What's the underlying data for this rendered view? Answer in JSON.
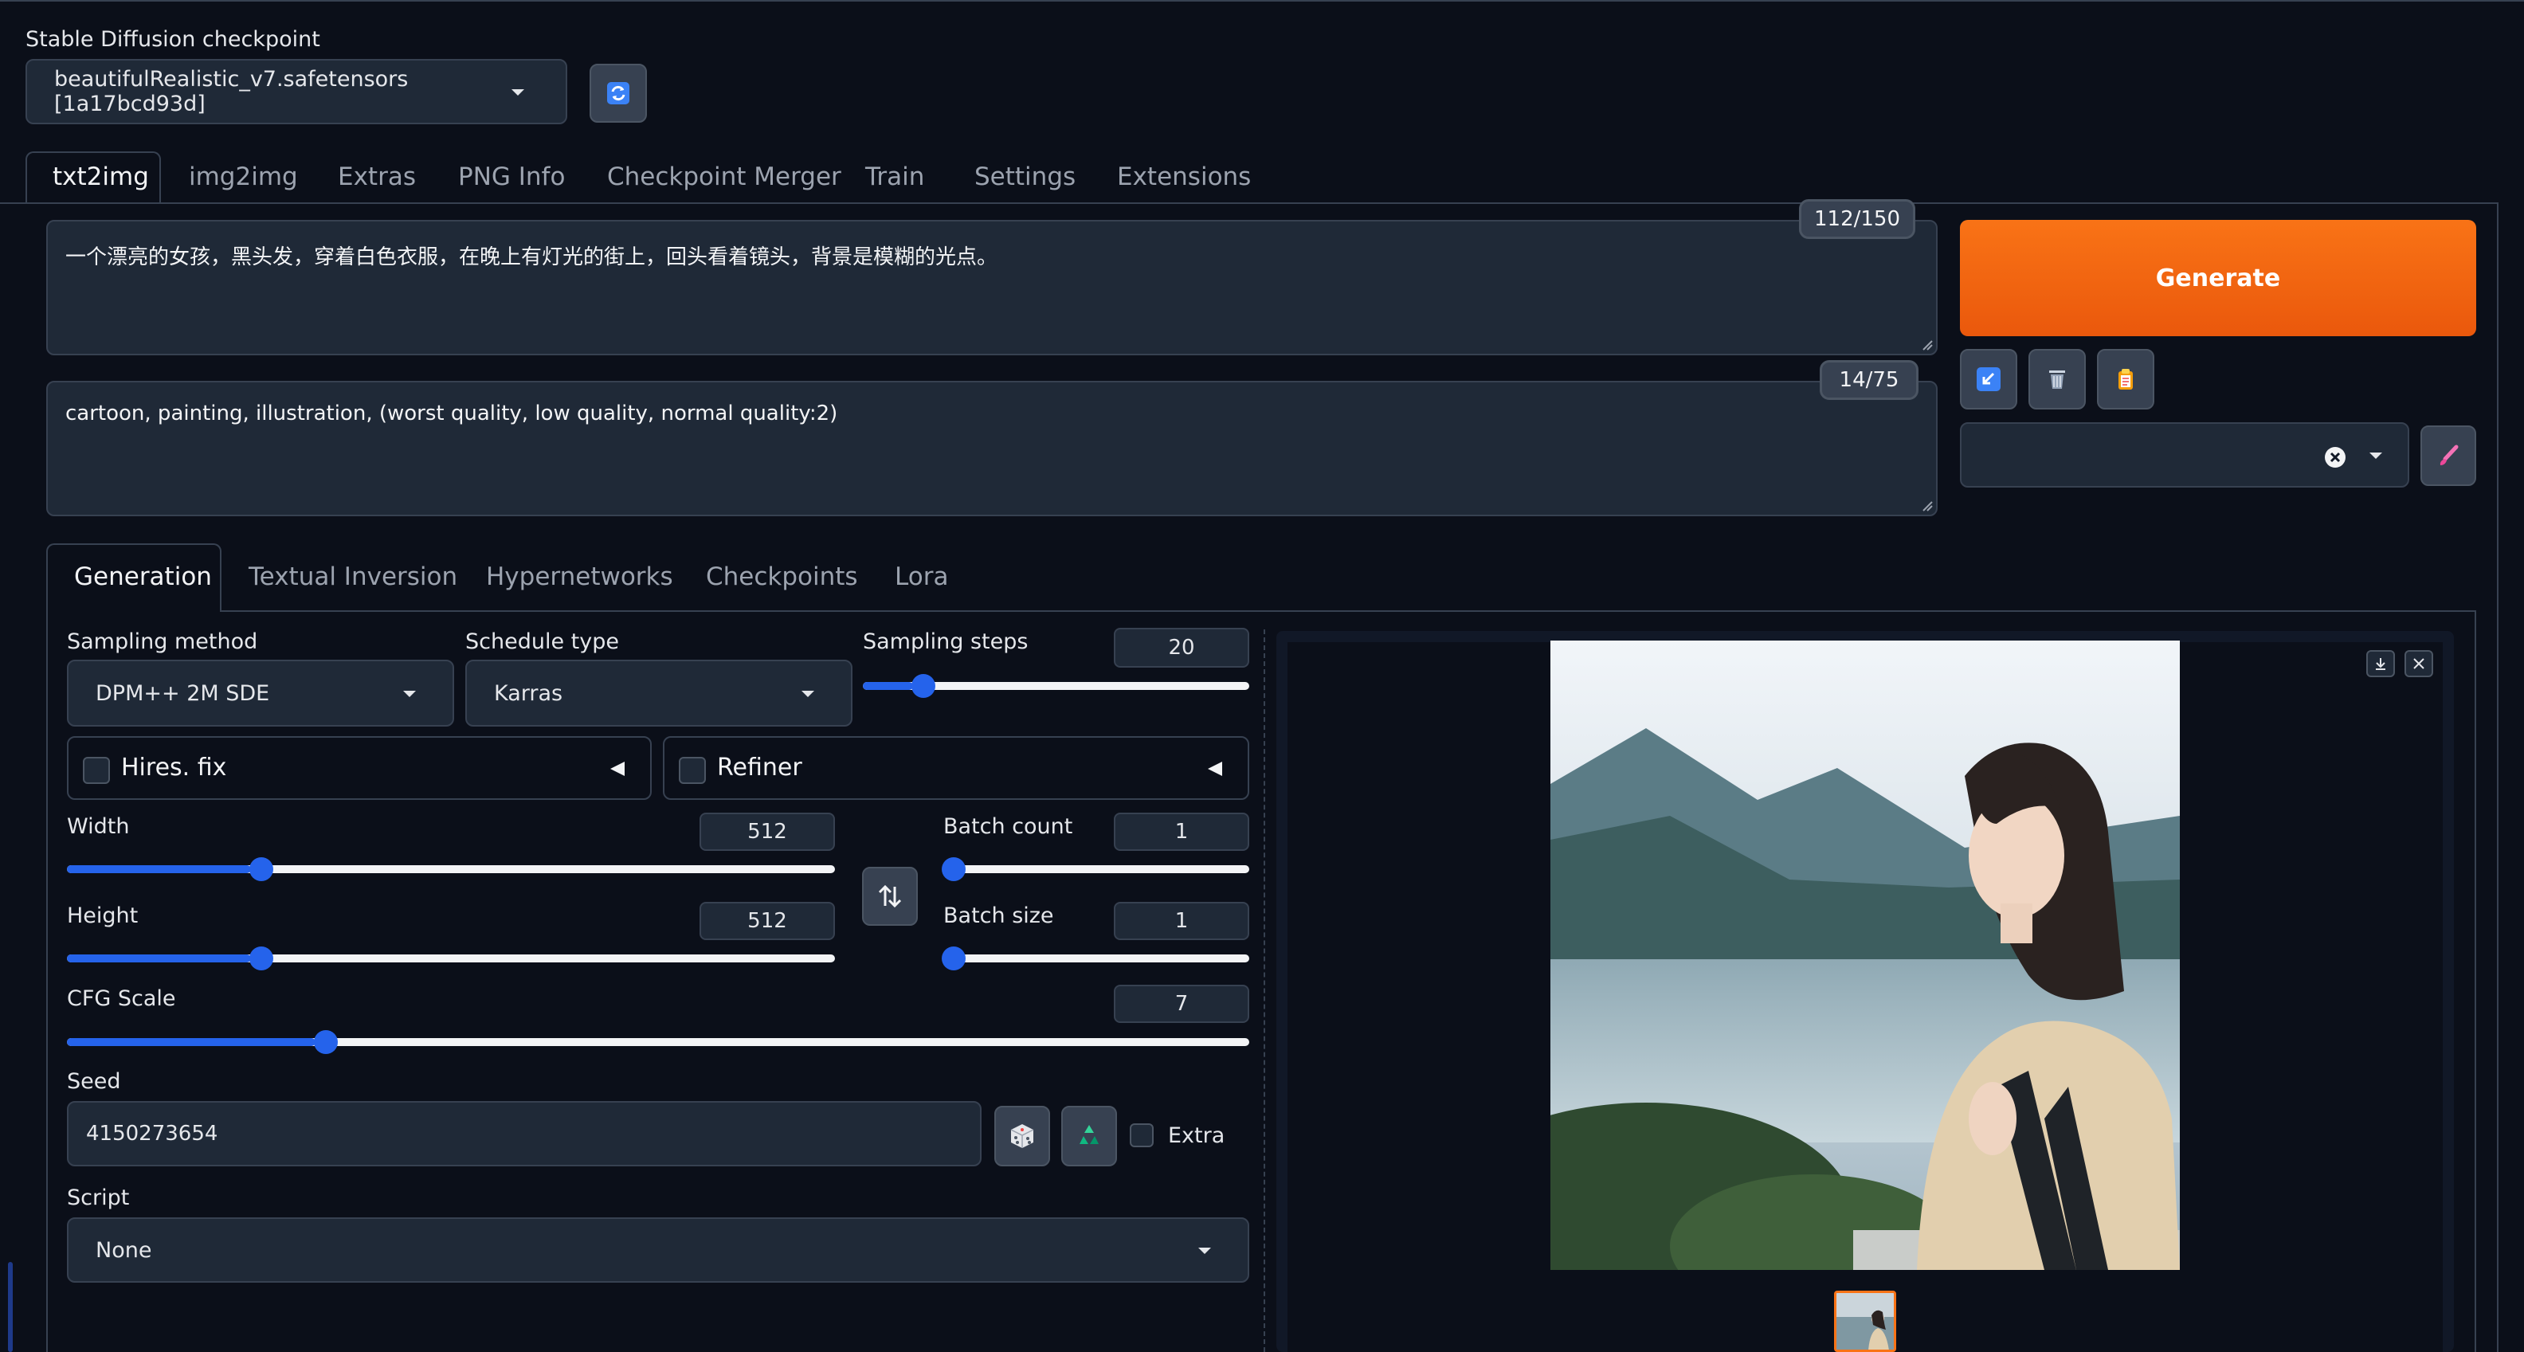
{
  "checkpoint": {
    "label": "Stable Diffusion checkpoint",
    "value": "beautifulRealistic_v7.safetensors [1a17bcd93d]"
  },
  "main_tabs": [
    "txt2img",
    "img2img",
    "Extras",
    "PNG Info",
    "Checkpoint Merger",
    "Train",
    "Settings",
    "Extensions"
  ],
  "prompt": {
    "positive": "一个漂亮的女孩，黑头发，穿着白色衣服，在晚上有灯光的街上，回头看着镜头，背景是模糊的光点。",
    "positive_count": "112/150",
    "negative": "cartoon, painting, illustration, (worst quality, low quality, normal quality:2)",
    "negative_count": "14/75"
  },
  "generate_label": "Generate",
  "sub_tabs": [
    "Generation",
    "Textual Inversion",
    "Hypernetworks",
    "Checkpoints",
    "Lora"
  ],
  "sampling": {
    "method_label": "Sampling method",
    "method_value": "DPM++ 2M SDE",
    "schedule_label": "Schedule type",
    "schedule_value": "Karras",
    "steps_label": "Sampling steps",
    "steps_value": "20",
    "steps_fraction": 0.13
  },
  "hires": {
    "label": "Hires. fix"
  },
  "refiner": {
    "label": "Refiner"
  },
  "width": {
    "label": "Width",
    "value": "512",
    "fraction": 0.24
  },
  "height": {
    "label": "Height",
    "value": "512",
    "fraction": 0.24
  },
  "batch_count": {
    "label": "Batch count",
    "value": "1",
    "fraction": 0.0
  },
  "batch_size": {
    "label": "Batch size",
    "value": "1",
    "fraction": 0.0
  },
  "cfg": {
    "label": "CFG Scale",
    "value": "7",
    "fraction": 0.21
  },
  "seed": {
    "label": "Seed",
    "value": "4150273654",
    "extra_label": "Extra"
  },
  "script": {
    "label": "Script",
    "value": "None"
  },
  "colors": {
    "accent": "#2563eb",
    "generate": "#ea580c",
    "background": "#0b0f19"
  }
}
